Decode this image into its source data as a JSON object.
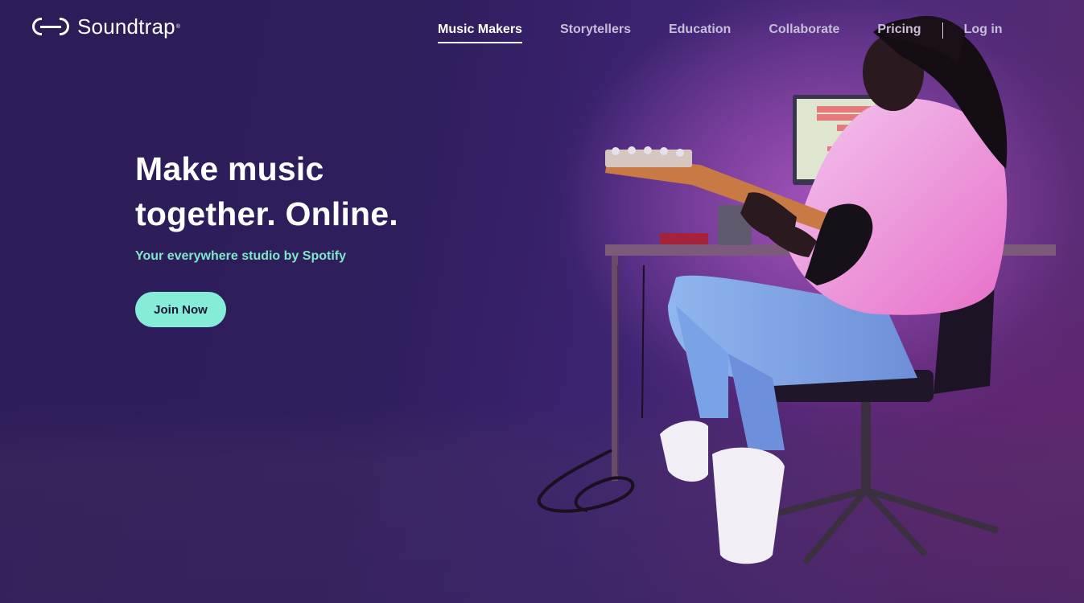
{
  "brand": {
    "name": "Soundtrap",
    "registered_mark": "®"
  },
  "nav": {
    "items": [
      {
        "label": "Music Makers",
        "active": true
      },
      {
        "label": "Storytellers",
        "active": false
      },
      {
        "label": "Education",
        "active": false
      },
      {
        "label": "Collaborate",
        "active": false
      },
      {
        "label": "Pricing",
        "active": false
      }
    ],
    "login_label": "Log in"
  },
  "hero": {
    "title_line1": "Make music",
    "title_line2": "together. Online.",
    "subtitle": "Your everywhere studio by Spotify",
    "cta_label": "Join Now"
  },
  "colors": {
    "background": "#2e1e5c",
    "accent_mint": "#84ecd7",
    "subtitle_green": "#7fe8c8",
    "nav_text": "#c7bed9"
  },
  "icons": {
    "logo": "soundtrap-logo-icon"
  }
}
